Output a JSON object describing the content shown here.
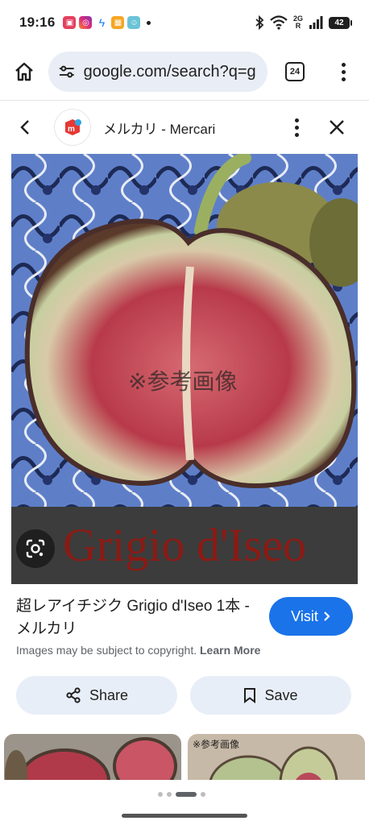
{
  "status_bar": {
    "time": "19:16",
    "network_label": "R",
    "network_gen": "2G",
    "battery": "42"
  },
  "browser": {
    "url": "google.com/search?q=g",
    "tab_count": "24"
  },
  "panel": {
    "site_name": "メルカリ - Mercari",
    "image_overlay_text": "※参考画像",
    "image_caption": "Grigio d'Iseo",
    "result_title": "超レアイチジク Grigio d'Iseo 1本 - メルカリ",
    "visit_label": "Visit",
    "copyright_text": "Images may be subject to copyright.",
    "learn_more_label": "Learn More",
    "share_label": "Share",
    "save_label": "Save"
  },
  "related": {
    "items": [
      {
        "caption": ""
      },
      {
        "caption": "※参考画像"
      }
    ]
  },
  "colors": {
    "accent": "#1a73e8",
    "omnibox_bg": "#e9edf5",
    "action_bg": "#e8eef8"
  }
}
